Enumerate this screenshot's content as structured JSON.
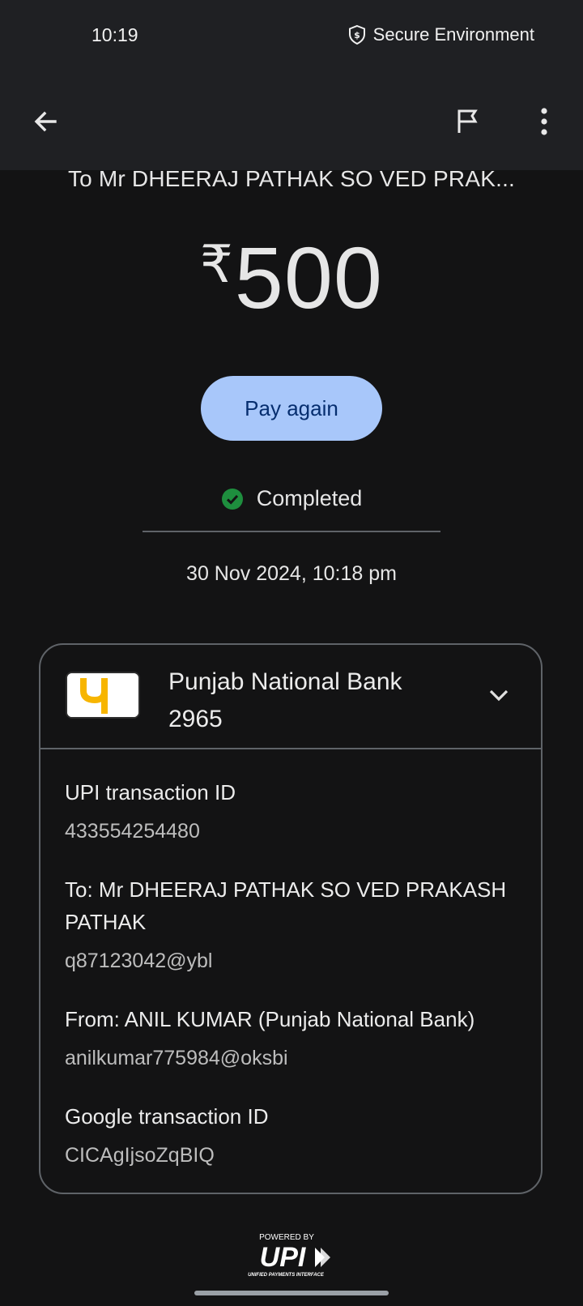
{
  "status_bar": {
    "time": "10:19",
    "secure_label": "Secure Environment",
    "secure_icon": "shield-dollar-icon"
  },
  "app_bar": {
    "back_icon": "arrow-left-icon",
    "flag_icon": "flag-icon",
    "more_icon": "more-vert-icon"
  },
  "payment": {
    "recipient_title": "To Mr DHEERAJ PATHAK SO VED PRAK...",
    "currency": "₹",
    "amount": "500",
    "pay_again_label": "Pay again",
    "status": "Completed",
    "status_color": "#1e8e3e",
    "datetime": "30 Nov 2024, 10:18 pm"
  },
  "bank": {
    "name": "Punjab National Bank",
    "account": "2965",
    "logo_color": "#f7b500"
  },
  "details": [
    {
      "label": "UPI transaction ID",
      "value": "433554254480"
    },
    {
      "label": "To: Mr DHEERAJ PATHAK SO VED PRAKASH PATHAK",
      "value": "q87123042@ybl"
    },
    {
      "label": "From: ANIL KUMAR (Punjab National Bank)",
      "value": "anilkumar775984@oksbi"
    },
    {
      "label": "Google transaction ID",
      "value": "CICAgIjsoZqBIQ"
    }
  ],
  "footer": {
    "powered_by": "POWERED BY",
    "upi_mark": "UPI",
    "upi_tagline": "UNIFIED PAYMENTS INTERFACE"
  },
  "theme": {
    "background": "#131314",
    "bar_background": "#1f2023",
    "accent_button": "#a8c7fa"
  }
}
